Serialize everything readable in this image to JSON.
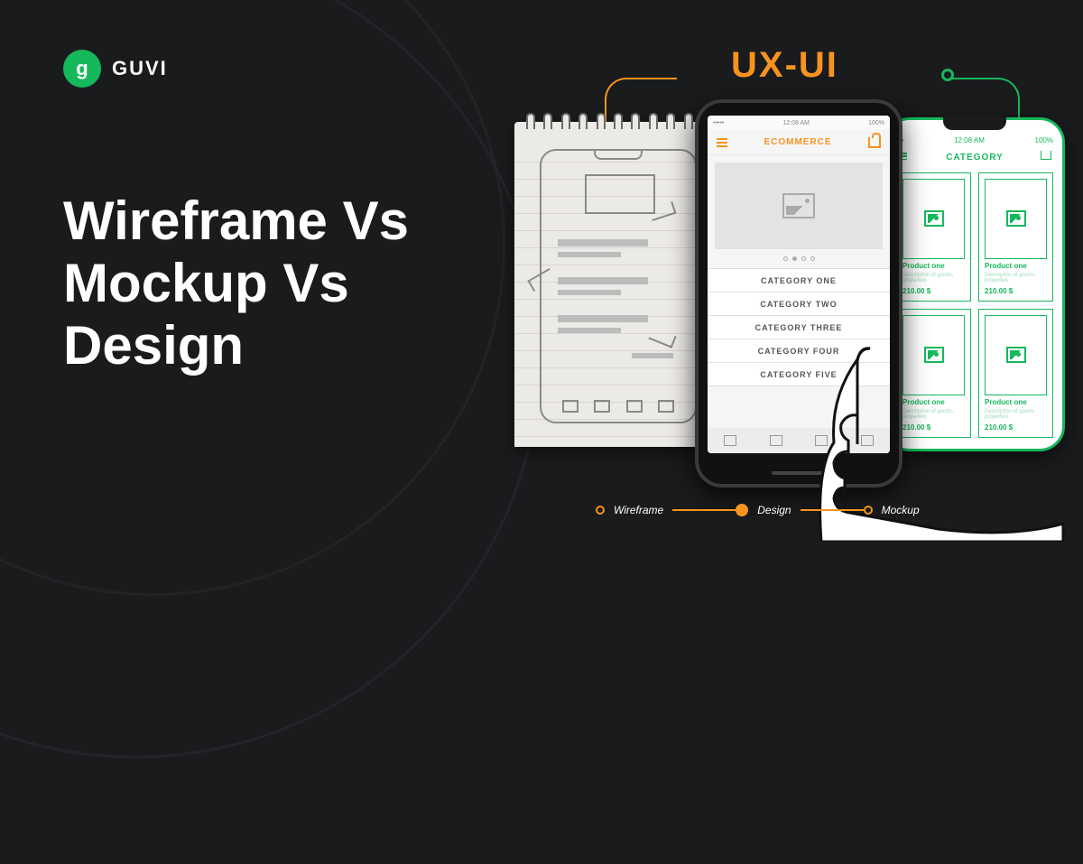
{
  "logo": {
    "text": "GUVI",
    "glyph": "g"
  },
  "headline": "Wireframe Vs\nMockup Vs\nDesign",
  "uxui": "UX-UI",
  "stepper": {
    "items": [
      "Wireframe",
      "Design",
      "Mockup"
    ],
    "active_index": 1
  },
  "design_phone": {
    "status": {
      "left": "•••••",
      "center": "12:08 AM",
      "right": "100%"
    },
    "app_title": "ECOMMERCE",
    "categories": [
      "CATEGORY ONE",
      "CATEGORY TWO",
      "CATEGORY THREE",
      "CATEGORY FOUR",
      "CATEGORY FIVE"
    ]
  },
  "mockup_phone": {
    "status": {
      "left": "•••",
      "center": "12:08 AM",
      "right": "100%"
    },
    "header": "CATEGORY",
    "card": {
      "title": "Product one",
      "desc": "Description of goods, properties",
      "price": "210.00 $"
    }
  },
  "colors": {
    "accent": "#f7931e",
    "brand": "#15b85b",
    "bg": "#1a1b1d"
  }
}
